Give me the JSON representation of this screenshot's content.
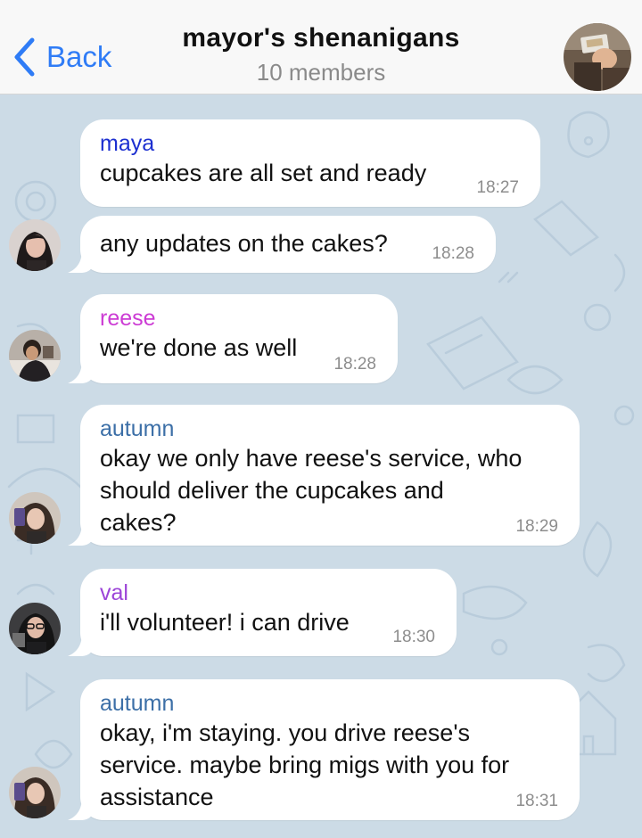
{
  "header": {
    "back_label": "Back",
    "title": "mayor's shenanigans",
    "subtitle": "10 members",
    "accent_color": "#2f7cf6",
    "avatar_icon": "group-photo-avatar"
  },
  "messages": [
    {
      "sender": "maya",
      "sender_color": "#1c2fd0",
      "text": "cupcakes are all set and ready",
      "time": "18:27",
      "avatar_icon": null
    },
    {
      "sender": "",
      "sender_color": "",
      "text": "any updates on the cakes?",
      "time": "18:28",
      "avatar_icon": "maya-avatar"
    },
    {
      "sender": "reese",
      "sender_color": "#cc3bd4",
      "text": "we're done as well",
      "time": "18:28",
      "avatar_icon": "reese-avatar"
    },
    {
      "sender": "autumn",
      "sender_color": "#3c6fa7",
      "text": "okay we only have reese's service, who\nshould deliver the cupcakes and\ncakes?",
      "time": "18:29",
      "avatar_icon": "autumn-avatar"
    },
    {
      "sender": "val",
      "sender_color": "#9c45d8",
      "text": "i'll volunteer! i can drive",
      "time": "18:30",
      "avatar_icon": "val-avatar"
    },
    {
      "sender": "autumn",
      "sender_color": "#3c6fa7",
      "text": "okay, i'm staying. you drive reese's\nservice. maybe bring migs with you for\nassistance",
      "time": "18:31",
      "avatar_icon": "autumn-avatar"
    }
  ],
  "colors": {
    "chat_background": "#ccdbe6",
    "bubble": "#ffffff",
    "timestamp": "#8d8d8d"
  }
}
